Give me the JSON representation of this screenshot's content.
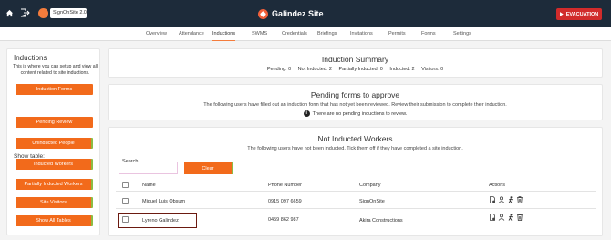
{
  "header": {
    "site_selector": "SignOnSite 2.0",
    "brand": "Galindez Site",
    "evacuation_label": "EVACUATION"
  },
  "nav": {
    "tabs": [
      "Overview",
      "Attendance",
      "Inductions",
      "SWMS",
      "Credentials",
      "Briefings",
      "Invitations",
      "Permits",
      "Forms",
      "Settings"
    ],
    "active": "Inductions"
  },
  "sidebar": {
    "title": "Inductions",
    "description": "This is where you can setup and view all content related to site inductions.",
    "forms_button": "Induction Forms",
    "show_table_label": "Show table:",
    "buttons": [
      "Pending Review",
      "Uninducted People",
      "Inducted Workers",
      "Partially Inducted Workers",
      "Site Visitors",
      "Show All Tables"
    ]
  },
  "summary": {
    "title": "Induction Summary",
    "counts": [
      "Pending: 0",
      "Not Inducted: 2",
      "Partially Inducted: 0",
      "Inducted: 2",
      "Visitors: 0"
    ]
  },
  "pending": {
    "title": "Pending forms to approve",
    "subtitle": "The following users have filled out an induction form that has not yet been reviewed. Review their submission to complete their induction.",
    "info": "There are no pending inductions to review."
  },
  "not_inducted": {
    "title": "Not Inducted Workers",
    "subtitle": "The following users have not been inducted. Tick them off if they have completed a site induction.",
    "search_label": "Search",
    "clear_label": "Clear",
    "columns": [
      "Name",
      "Phone Number",
      "Company",
      "Actions"
    ],
    "rows": [
      {
        "name": "Miguel Luis Obsum",
        "phone": "0915 097 6659",
        "company": "SignOnSite"
      },
      {
        "name": "Lyreno Galindez",
        "phone": "0459 862 987",
        "company": "Akira Constructions"
      }
    ]
  },
  "colors": {
    "accent": "#f26a1b",
    "topbar": "#1d2b3a",
    "evacuation": "#d12b2b"
  }
}
